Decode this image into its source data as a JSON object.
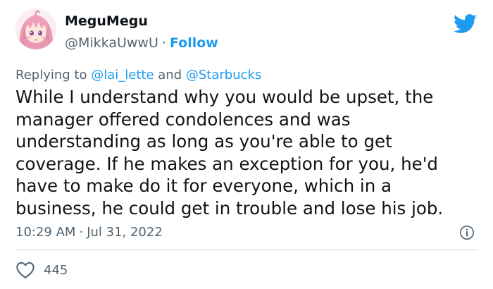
{
  "author": {
    "display_name": "MeguMegu",
    "handle": "@MikkaUwwU",
    "separator": "·",
    "follow_label": "Follow"
  },
  "reply": {
    "prefix": "Replying to",
    "mention_1": "@lai_lette",
    "conjunction": "and",
    "mention_2": "@Starbucks"
  },
  "tweet": {
    "lines": [
      "While I understand why you would be upset, the",
      "manager offered condolences and was",
      "understanding as long as you're able to get",
      "coverage. If he makes an exception for you, he'd",
      "have to make do it for everyone, which in a",
      "business, he could get in trouble and lose his job."
    ]
  },
  "meta": {
    "time": "10:29 AM",
    "separator": "·",
    "date": "Jul 31, 2022"
  },
  "engagement": {
    "likes": "445"
  },
  "icons": {
    "brand": "twitter-bird-icon",
    "info": "info-icon",
    "like": "heart-icon"
  },
  "colors": {
    "brand_blue": "#1d9bf0",
    "text_primary": "#0f1419",
    "text_secondary": "#536471",
    "divider": "#cfd9de"
  }
}
